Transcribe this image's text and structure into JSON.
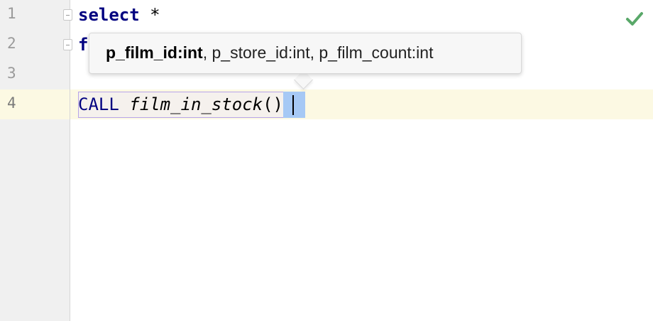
{
  "editor": {
    "line_numbers": [
      "1",
      "2",
      "3",
      "4"
    ],
    "lines": {
      "l1_keyword": "select",
      "l1_rest": " *",
      "l2_text": "f",
      "l4_keyword": "CALL",
      "l4_function": "film_in_stock",
      "l4_paren": "()"
    },
    "inspection_status": "checkmark-icon"
  },
  "param_tooltip": {
    "current_param": "p_film_id:int",
    "rest_params": ", p_store_id:int, p_film_count:int"
  },
  "colors": {
    "keyword": "#000080",
    "current_line": "#fcf9e3",
    "selection": "#a6c9f5",
    "check": "#59a869"
  }
}
